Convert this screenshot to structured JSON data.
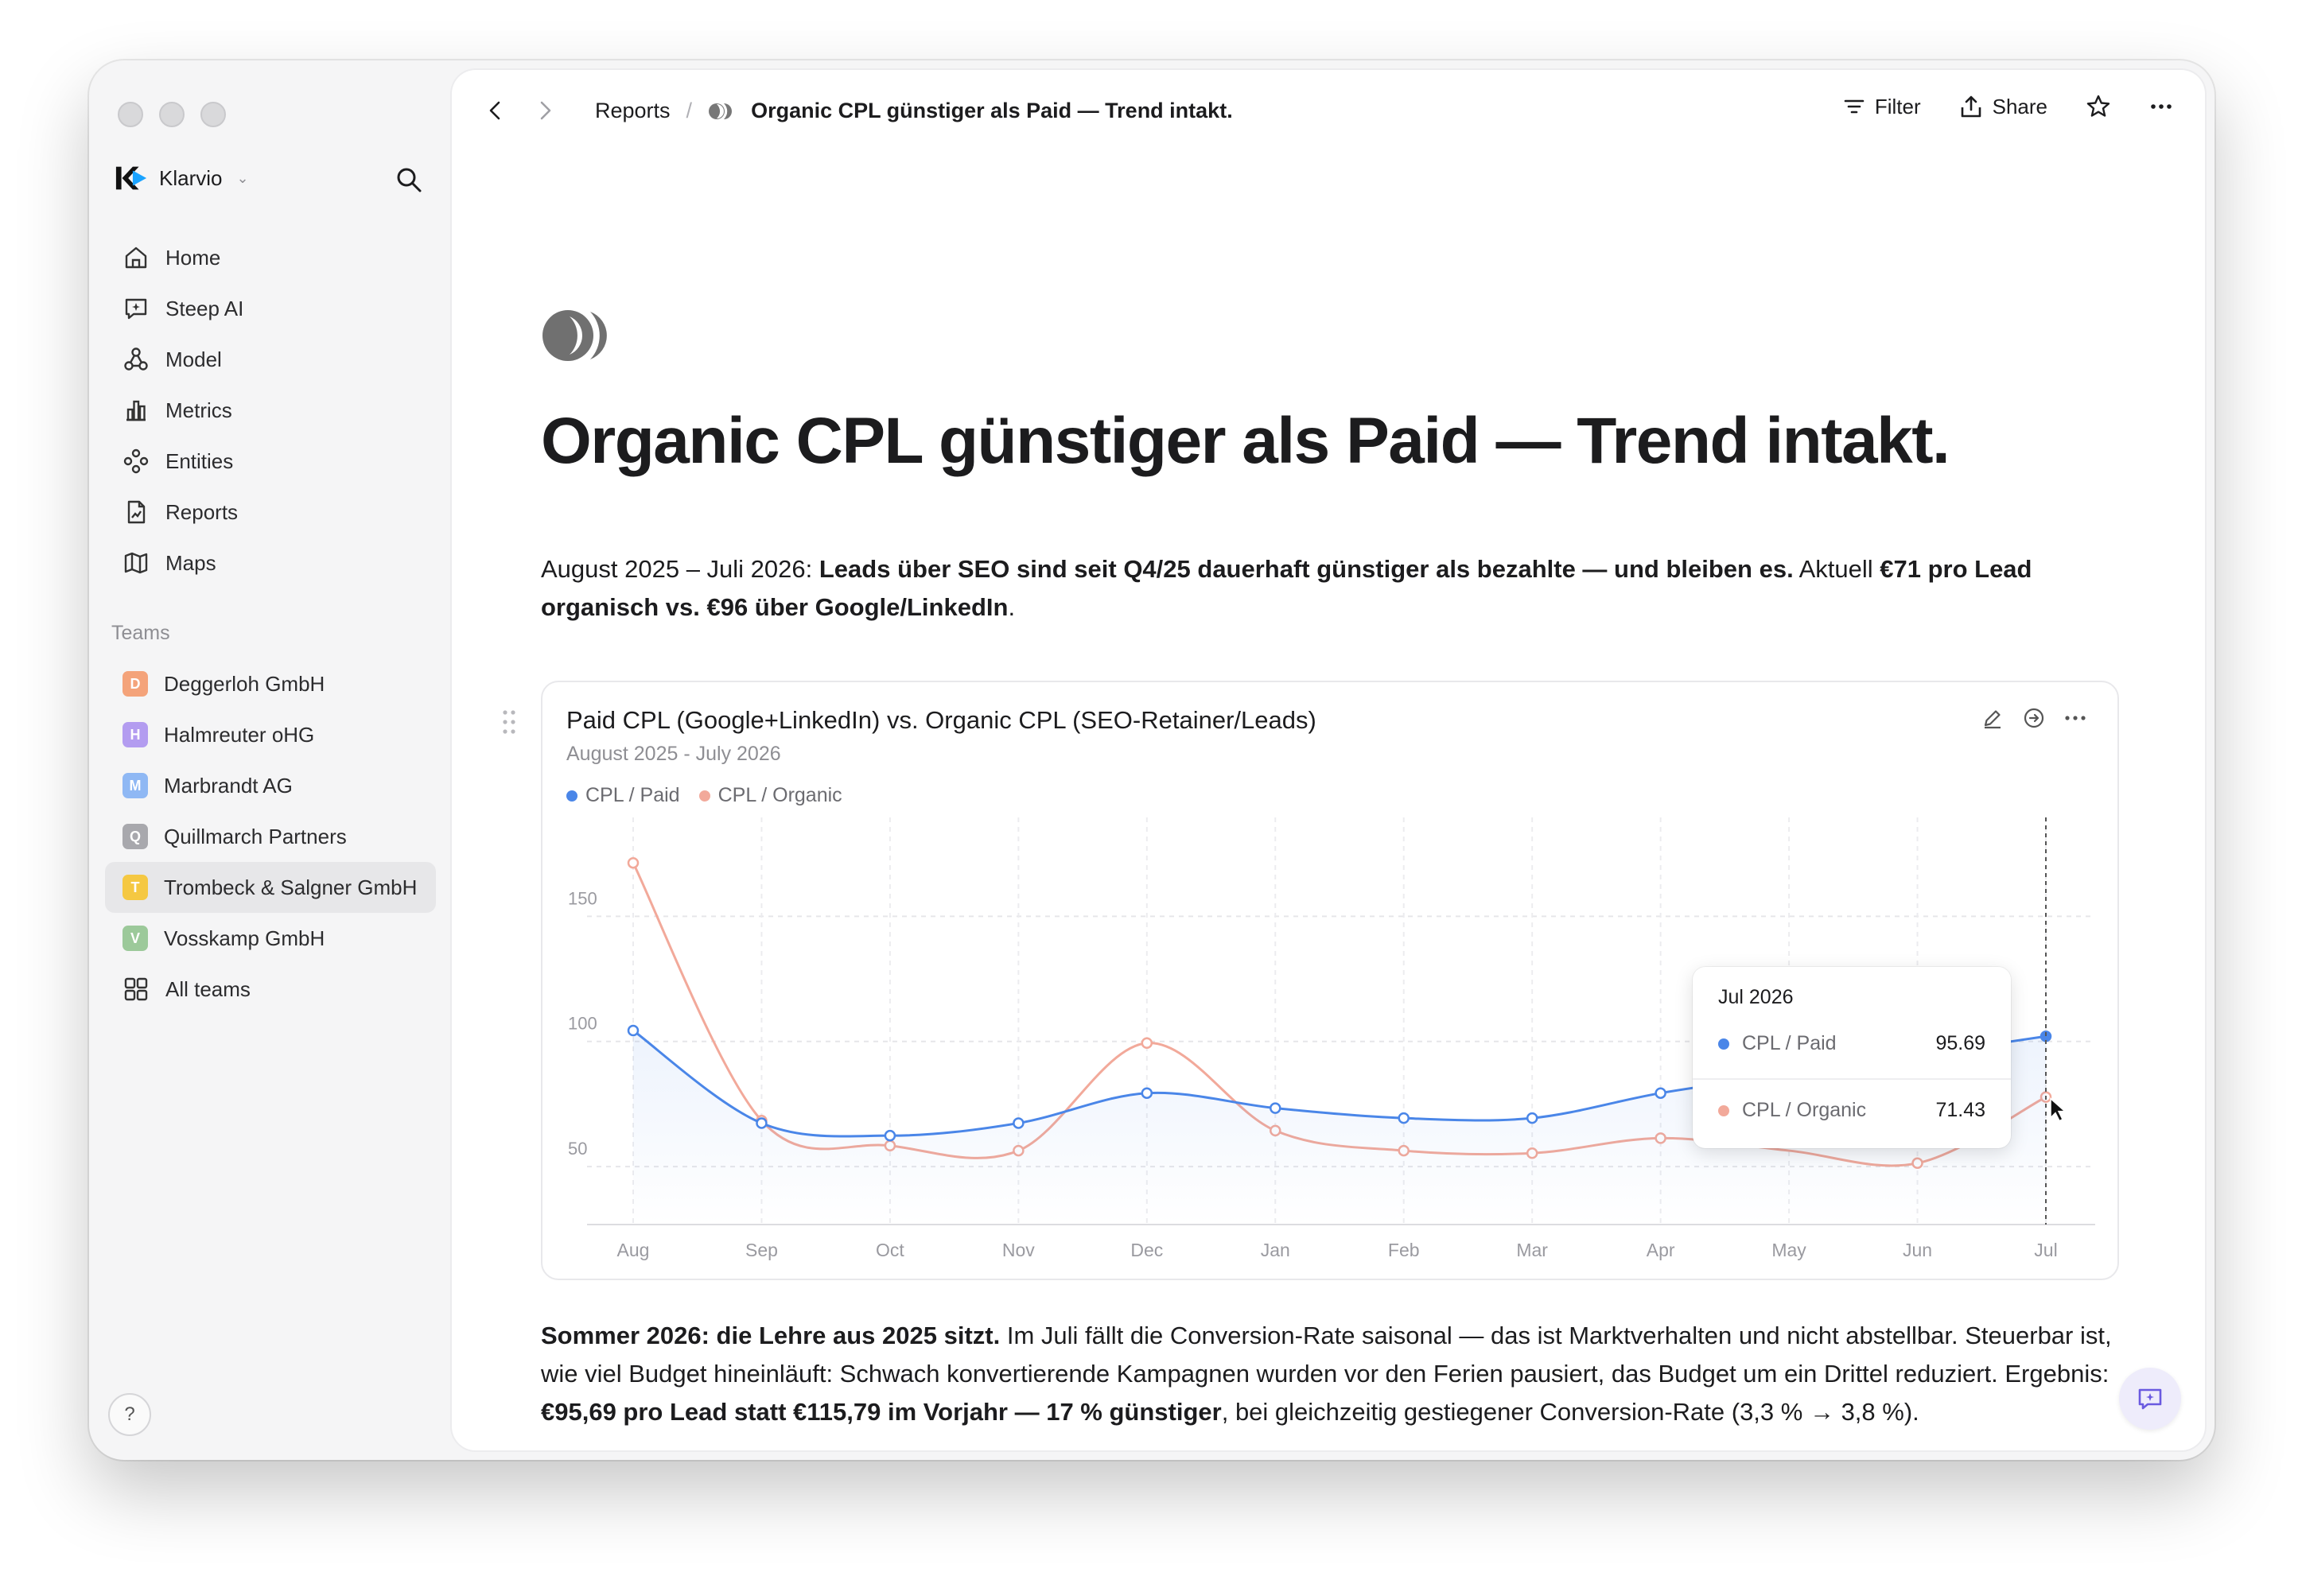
{
  "workspace": {
    "name": "Klarvio"
  },
  "nav": {
    "items": [
      {
        "label": "Home",
        "icon": "home-icon"
      },
      {
        "label": "Steep AI",
        "icon": "chat-sparkle-icon"
      },
      {
        "label": "Model",
        "icon": "model-icon"
      },
      {
        "label": "Metrics",
        "icon": "bar-chart-icon"
      },
      {
        "label": "Entities",
        "icon": "entities-icon"
      },
      {
        "label": "Reports",
        "icon": "report-icon"
      },
      {
        "label": "Maps",
        "icon": "map-icon"
      }
    ]
  },
  "teams": {
    "title": "Teams",
    "items": [
      {
        "label": "Deggerloh GmbH",
        "initial": "D",
        "color": "#f4a37a"
      },
      {
        "label": "Halmreuter oHG",
        "initial": "H",
        "color": "#b39cf0"
      },
      {
        "label": "Marbrandt AG",
        "initial": "M",
        "color": "#8fb8f4"
      },
      {
        "label": "Quillmarch Partners",
        "initial": "Q",
        "color": "#a8a8ad"
      },
      {
        "label": "Trombeck & Salgner GmbH",
        "initial": "T",
        "color": "#f5c842"
      },
      {
        "label": "Vosskamp GmbH",
        "initial": "V",
        "color": "#9cc99a"
      }
    ],
    "all_label": "All teams"
  },
  "help": {
    "label": "?"
  },
  "topbar": {
    "breadcrumb_root": "Reports",
    "breadcrumb_sep": "/",
    "breadcrumb_current": "Organic CPL günstiger als Paid — Trend intakt.",
    "filter_label": "Filter",
    "share_label": "Share"
  },
  "page": {
    "title": "Organic CPL günstiger als Paid — Trend intakt.",
    "lead_1": "August 2025 – Juli 2026: ",
    "lead_2": "Leads über SEO sind seit Q4/25 dauerhaft günstiger als bezahlte — und bleiben es.",
    "lead_3": " Aktuell ",
    "lead_4": "€71 pro Lead organisch vs. €96 über Google/LinkedIn",
    "lead_5": ".",
    "para_1": "Sommer 2026: die Lehre aus 2025 sitzt.",
    "para_2": " Im Juli fällt die Conversion-Rate saisonal — das ist Marktverhalten und nicht abstellbar. Steuerbar ist, wie viel Budget hineinläuft: Schwach konvertierende Kampagnen wurden vor den Ferien pausiert, das Budget um ein Drittel reduziert. Ergebnis: ",
    "para_3": "€95,69 pro Lead statt €115,79 im Vorjahr — 17 % günstiger",
    "para_4": ", bei gleichzeitig gestiegener Conversion-Rate (3,3 % → 3,8 %)."
  },
  "tooltip": {
    "month": "Jul 2026",
    "paid_name": "CPL / Paid",
    "paid_value": "95.69",
    "organic_name": "CPL / Organic",
    "organic_value": "71.43"
  },
  "chart_data": {
    "type": "line",
    "title": "Paid CPL (Google+LinkedIn) vs. Organic CPL (SEO-Retainer/Leads)",
    "subtitle": "August 2025 - July 2026",
    "categories": [
      "Aug",
      "Sep",
      "Oct",
      "Nov",
      "Dec",
      "Jan",
      "Feb",
      "Mar",
      "Apr",
      "May",
      "Jun",
      "Jul"
    ],
    "yticks": [
      50,
      100,
      150
    ],
    "ylim": [
      30,
      180
    ],
    "grid": true,
    "legend_position": "top-left",
    "series": [
      {
        "name": "CPL / Paid",
        "color": "#4a86e8",
        "values": [
          98,
          61,
          56,
          61,
          73,
          67,
          63,
          63,
          73,
          null,
          null,
          95.69
        ]
      },
      {
        "name": "CPL / Organic",
        "color": "#f2a99a",
        "values": [
          165,
          62,
          52,
          50,
          93,
          58,
          50,
          49,
          55,
          null,
          45,
          71.43
        ]
      }
    ]
  },
  "colors": {
    "accent_paid": "#4a86e8",
    "accent_organic": "#f2a99a"
  }
}
